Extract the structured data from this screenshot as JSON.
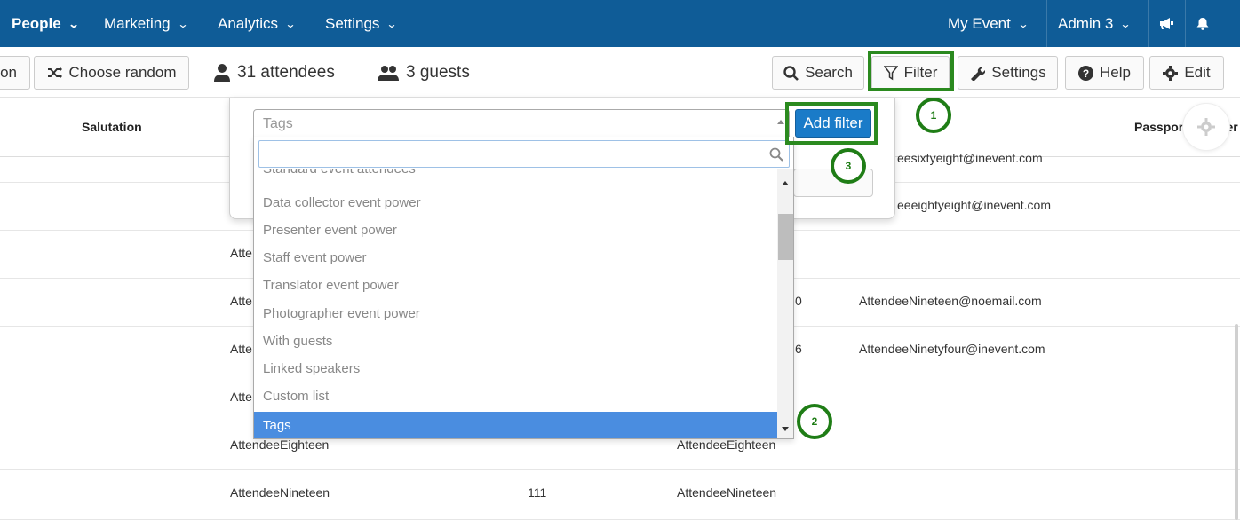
{
  "nav": {
    "people": "People",
    "marketing": "Marketing",
    "analytics": "Analytics",
    "settings": "Settings",
    "event": "My Event",
    "admin": "Admin 3"
  },
  "toolbar": {
    "partial_button": "on",
    "choose_random": "Choose random",
    "attendees": "31 attendees",
    "guests": "3 guests",
    "search": "Search",
    "filter": "Filter",
    "settings": "Settings",
    "help": "Help",
    "edit": "Edit"
  },
  "table": {
    "headers": {
      "salutation": "Salutation",
      "passport": "Passport Number"
    },
    "partial_emails": [
      "eesixtyeight@inevent.com",
      "eeeightyeight@inevent.com"
    ],
    "rows": [
      {
        "name": "AttendeeNineteen",
        "num": "0",
        "email": "AttendeeNineteen@noemail.com"
      },
      {
        "name": "AttendeeNinetyfour",
        "num": "6",
        "email": "AttendeeNinetyfour@inevent.com"
      },
      {
        "name": "AttendeeEighteen",
        "num": "",
        "name2": "AttendeeEighteen",
        "email": ""
      },
      {
        "name": "AttendeeNineteen",
        "num": "111",
        "name2": "AttendeeNineteen",
        "email": ""
      }
    ],
    "partial_names": [
      "Atte",
      "Atte",
      "Atte",
      "Atte"
    ]
  },
  "filter_popup": {
    "select_value": "Tags",
    "add_filter": "Add filter",
    "search_placeholder": "",
    "options": [
      "Standard event attendees",
      "Data collector event power",
      "Presenter event power",
      "Staff event power",
      "Translator event power",
      "Photographer event power",
      "With guests",
      "Linked speakers",
      "Custom list",
      "Tags"
    ],
    "selected_option": "Tags"
  },
  "annotations": {
    "step1": "1",
    "step2": "2",
    "step3": "3"
  },
  "colors": {
    "nav_bg": "#0f5c97",
    "accent": "#1a7bc8",
    "annotation": "#2b8a1f",
    "selected": "#4a8de0"
  }
}
